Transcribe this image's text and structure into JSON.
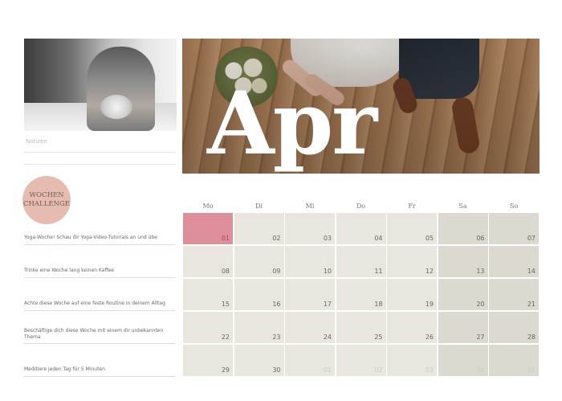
{
  "month_title": "Apr",
  "notes_label": "Notizen",
  "badge": {
    "line1": "WOCHEN",
    "line2": "CHALLENGE"
  },
  "weekdays": [
    "Mo",
    "Di",
    "Mi",
    "Do",
    "Fr",
    "Sa",
    "So"
  ],
  "challenges": [
    "Yoga-Woche! Schau dir Yoga-Video-Tutorials an und übe",
    "Trinke eine Woche lang keinen Kaffee",
    "Achte diese Woche auf eine feste Routine in deinem Alltag",
    "Beschäftige dich diese Woche mit einem dir unbekannten Thema",
    "Meditiere jeden Tag für 5 Minuten"
  ],
  "weeks": [
    [
      "01",
      "02",
      "03",
      "04",
      "05",
      "06",
      "07"
    ],
    [
      "08",
      "09",
      "10",
      "11",
      "12",
      "13",
      "14"
    ],
    [
      "15",
      "16",
      "17",
      "18",
      "19",
      "20",
      "21"
    ],
    [
      "22",
      "23",
      "24",
      "25",
      "26",
      "27",
      "28"
    ],
    [
      "29",
      "30",
      "01",
      "02",
      "03",
      "04",
      "05"
    ]
  ],
  "highlight_day": "01",
  "colors": {
    "highlight": "#de8f9c",
    "badge": "#e6bcb0",
    "weekday_cell": "#e9e6df",
    "weekend_cell": "#dcd9d0"
  }
}
